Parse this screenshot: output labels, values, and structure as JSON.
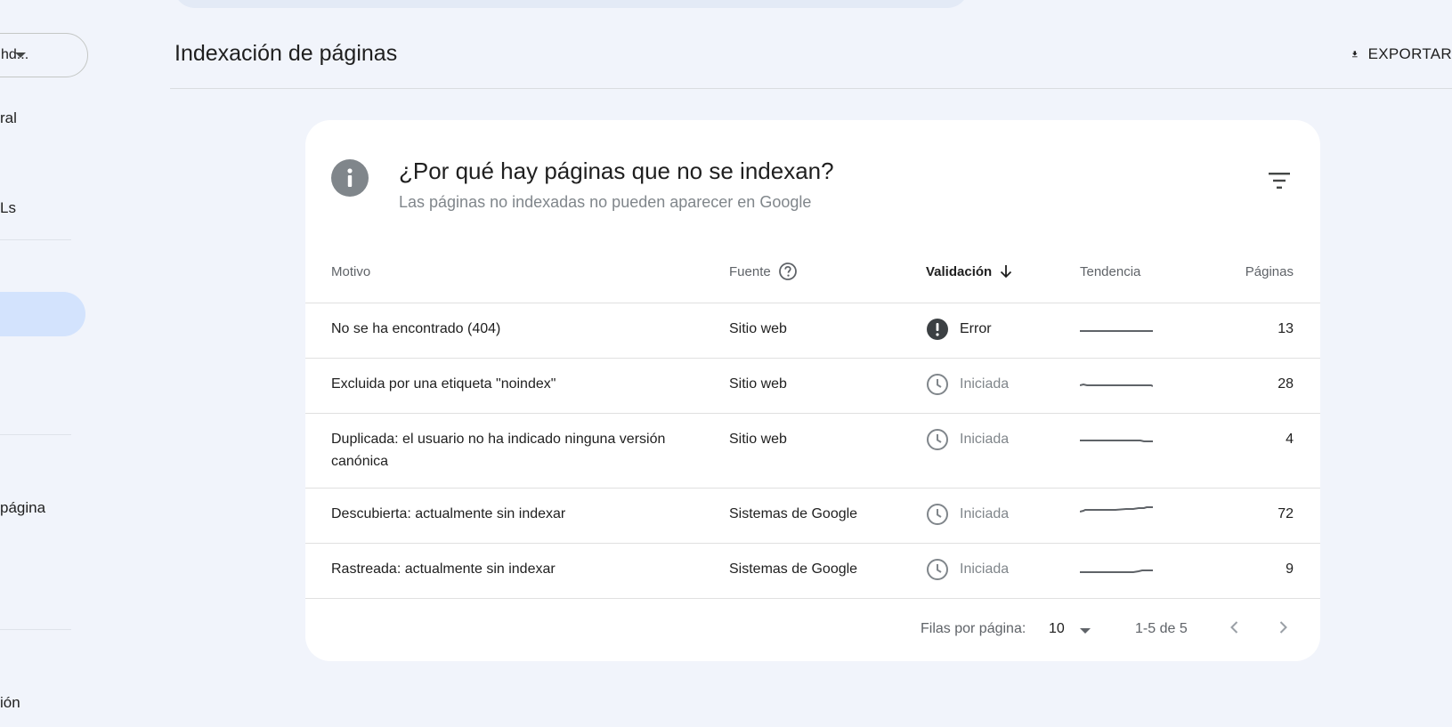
{
  "sidebar": {
    "property_label": "hd...",
    "items": [
      "ral",
      "Ls",
      "página",
      "ión"
    ]
  },
  "header": {
    "title": "Indexación de páginas",
    "export_label": "EXPORTAR"
  },
  "card": {
    "title": "¿Por qué hay páginas que no se indexan?",
    "subtitle": "Las páginas no indexadas no pueden aparecer en Google"
  },
  "table": {
    "columns": {
      "motivo": "Motivo",
      "fuente": "Fuente",
      "validacion": "Validación",
      "tendencia": "Tendencia",
      "paginas": "Páginas"
    },
    "rows": [
      {
        "motivo": "No se ha encontrado (404)",
        "fuente": "Sitio web",
        "validacion": "Error",
        "status": "error",
        "paginas": "13"
      },
      {
        "motivo": "Excluida por una etiqueta \"noindex\"",
        "fuente": "Sitio web",
        "validacion": "Iniciada",
        "status": "started",
        "paginas": "28"
      },
      {
        "motivo": "Duplicada: el usuario no ha indicado ninguna versión canónica",
        "fuente": "Sitio web",
        "validacion": "Iniciada",
        "status": "started",
        "paginas": "4"
      },
      {
        "motivo": "Descubierta: actualmente sin indexar",
        "fuente": "Sistemas de Google",
        "validacion": "Iniciada",
        "status": "started",
        "paginas": "72"
      },
      {
        "motivo": "Rastreada: actualmente sin indexar",
        "fuente": "Sistemas de Google",
        "validacion": "Iniciada",
        "status": "started",
        "paginas": "9"
      }
    ]
  },
  "footer": {
    "rows_per_page_label": "Filas por página:",
    "rows_per_page_value": "10",
    "range": "1-5 de 5"
  },
  "icons": {
    "info": "info-icon",
    "filter": "filter-icon",
    "help": "help-circle-icon",
    "sort": "arrow-down-icon",
    "error": "error-icon",
    "clock": "clock-icon",
    "download": "download-icon",
    "prev": "chevron-left-icon",
    "next": "chevron-right-icon"
  },
  "colors": {
    "background": "#f1f4fb",
    "card": "#ffffff",
    "active_nav": "#d3e3fd",
    "error_icon": "#3c4043",
    "muted": "#80868b"
  }
}
